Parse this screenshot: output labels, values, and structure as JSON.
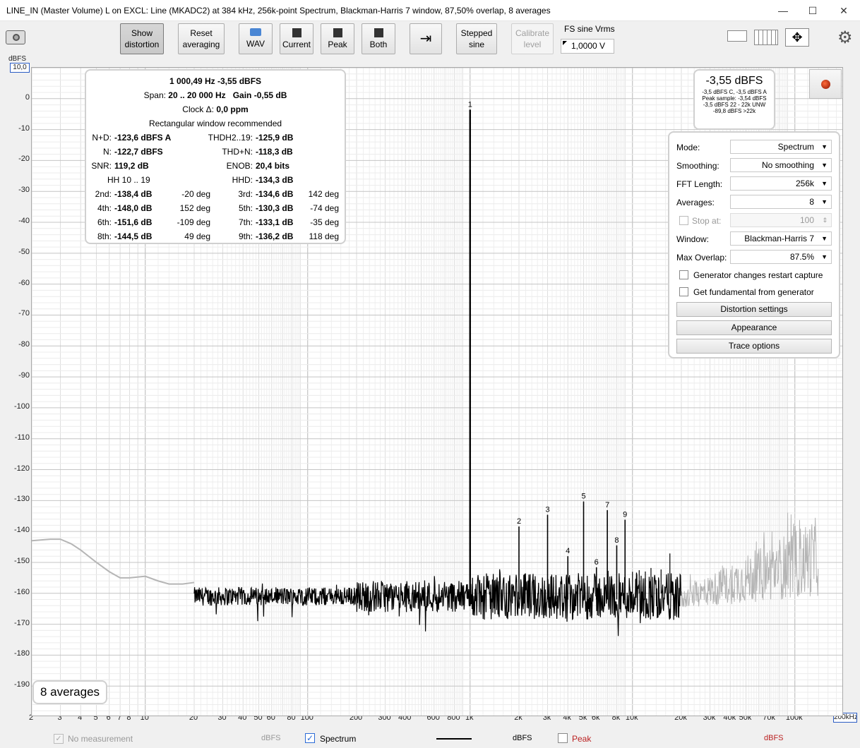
{
  "window": {
    "title": "LINE_IN (Master Volume) L on EXCL: Line (MKADC2) at 384 kHz, 256k-point Spectrum, Blackman-Harris 7 window, 87,50% overlap, 8 averages",
    "minimize": "—",
    "maximize": "☐",
    "close": "✕"
  },
  "toolbar": {
    "show_distortion_1": "Show",
    "show_distortion_2": "distortion",
    "reset_averaging_1": "Reset",
    "reset_averaging_2": "averaging",
    "wav": "WAV",
    "current": "Current",
    "peak": "Peak",
    "both": "Both",
    "stepped_sine_1": "Stepped",
    "stepped_sine_2": "sine",
    "calibrate_level_1": "Calibrate",
    "calibrate_level_2": "level",
    "fs_sine_label": "FS sine Vrms",
    "fs_sine_value": "1,0000 V"
  },
  "plot": {
    "y_unit": "dBFS",
    "y_top": "10,0",
    "x_right": "200kHz",
    "y_ticks": [
      "0",
      "-10",
      "-20",
      "-30",
      "-40",
      "-50",
      "-60",
      "-70",
      "-80",
      "-90",
      "-100",
      "-110",
      "-120",
      "-130",
      "-140",
      "-150",
      "-160",
      "-170",
      "-180",
      "-190"
    ],
    "x_ticks": [
      "2",
      "3",
      "4",
      "5",
      "6",
      "7",
      "8",
      "10",
      "20",
      "30",
      "40",
      "50",
      "60",
      "80",
      "100",
      "200",
      "300",
      "400",
      "600",
      "800",
      "1k",
      "2k",
      "3k",
      "4k",
      "5k",
      "6k",
      "8k",
      "10k",
      "20k",
      "30k",
      "40k",
      "50k",
      "70k",
      "100k",
      "2"
    ],
    "harmonic_markers": [
      "1",
      "2",
      "3",
      "4",
      "5",
      "6",
      "7",
      "8",
      "9"
    ]
  },
  "stats": {
    "fundamental": "1 000,49 Hz  -3,55 dBFS",
    "span_label": "Span:",
    "span_value": "20 .. 20 000 Hz",
    "gain_label": "Gain",
    "gain_value": "-0,55 dB",
    "clock_label": "Clock Δ:",
    "clock_value": "0,0 ppm",
    "window_note": "Rectangular window recommended",
    "nd_label": "N+D:",
    "nd_value": "-123,6 dBFS A",
    "thd_label": "THDH2..19:",
    "thd_value": "-125,9 dB",
    "n_label": "N:",
    "n_value": "-122,7 dBFS",
    "thdn_label": "THD+N:",
    "thdn_value": "-118,3 dB",
    "snr_label": "SNR:",
    "snr_value": "119,2 dB",
    "enob_label": "ENOB:",
    "enob_value": "20,4 bits",
    "hh_label": "HH 10 .. 19",
    "hhd_label": "HHD:",
    "hhd_value": "-134,3 dB",
    "harmonics": [
      {
        "l1": "2nd:",
        "v1": "-138,4 dB",
        "p1": "-20 deg",
        "l2": "3rd:",
        "v2": "-134,6 dB",
        "p2": "142 deg"
      },
      {
        "l1": "4th:",
        "v1": "-148,0 dB",
        "p1": "152 deg",
        "l2": "5th:",
        "v2": "-130,3 dB",
        "p2": "-74 deg"
      },
      {
        "l1": "6th:",
        "v1": "-151,6 dB",
        "p1": "-109 deg",
        "l2": "7th:",
        "v2": "-133,1 dB",
        "p2": "-35 deg"
      },
      {
        "l1": "8th:",
        "v1": "-144,5 dB",
        "p1": "49 deg",
        "l2": "9th:",
        "v2": "-136,2 dB",
        "p2": "118 deg"
      }
    ]
  },
  "level_box": {
    "main": "-3,55 dBFS",
    "l1": "-3,5 dBFS C, -3,5 dBFS A",
    "l2": "Peak sample: -3,54 dBFS",
    "l3": "-3,5 dBFS 22 - 22k UNW",
    "l4": "-89,8 dBFS >22k"
  },
  "controls": {
    "mode_label": "Mode:",
    "mode_value": "Spectrum",
    "smoothing_label": "Smoothing:",
    "smoothing_value": "No smoothing",
    "fft_label": "FFT Length:",
    "fft_value": "256k",
    "averages_label": "Averages:",
    "averages_value": "8",
    "stop_at_label": "Stop at:",
    "stop_at_value": "100",
    "window_label": "Window:",
    "window_value": "Blackman-Harris 7",
    "overlap_label": "Max Overlap:",
    "overlap_value": "87.5%",
    "gen_restart": "Generator changes restart capture",
    "gen_fundamental": "Get fundamental from generator",
    "distortion_settings": "Distortion settings",
    "appearance": "Appearance",
    "trace_options": "Trace options"
  },
  "averages_badge": "8 averages",
  "legend": {
    "no_measurement": "No measurement",
    "no_measurement_unit": "dBFS",
    "spectrum": "Spectrum",
    "spectrum_unit": "dBFS",
    "peak": "Peak",
    "peak_unit": "dBFS"
  }
}
